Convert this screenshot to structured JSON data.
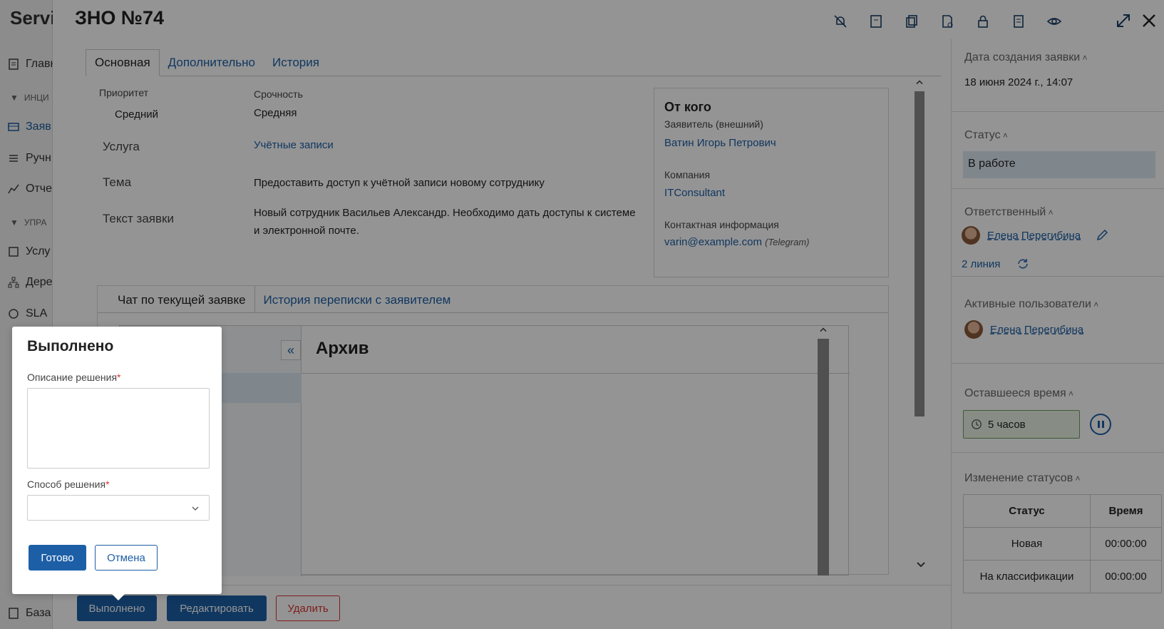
{
  "app": {
    "logo": "Servi",
    "nav": [
      {
        "label": "Главн",
        "icon": "document-icon"
      },
      {
        "label": "ИНЦИ",
        "group": true
      },
      {
        "label": "Заяв",
        "icon": "requests-icon",
        "active": true
      },
      {
        "label": "Ручн",
        "icon": "list-icon"
      },
      {
        "label": "Отче",
        "icon": "chart-icon"
      },
      {
        "label": "УПРА",
        "group": true
      },
      {
        "label": "Услу",
        "icon": "services-icon"
      },
      {
        "label": "Дере",
        "icon": "tree-icon"
      },
      {
        "label": "SLA",
        "icon": "sla-icon"
      },
      {
        "label": "База",
        "icon": "knowledge-icon"
      }
    ]
  },
  "request": {
    "title": "ЗНО №74",
    "tabs": [
      "Основная",
      "Дополнительно",
      "История"
    ],
    "priority_label": "Приоритет",
    "priority_value": "Средний",
    "urgency_label": "Срочность",
    "urgency_value": "Средняя",
    "service_label": "Услуга",
    "service_value": "Учётные записи",
    "topic_label": "Тема",
    "topic_value": "Предоставить доступ к учётной записи новому сотруднику",
    "text_label": "Текст заявки",
    "text_value_line1": "Новый сотрудник Васильев Александр. Необходимо дать доступы к системе",
    "text_value_line2": "и электронной почте."
  },
  "from": {
    "title": "От кого",
    "applicant_label": "Заявитель (внешний)",
    "applicant_value": "Ватин Игорь Петрович",
    "company_label": "Компания",
    "company_value": "ITConsultant",
    "contact_label": "Контактная информация",
    "contact_value": "varin@example.com",
    "contact_channel": "(Telegram)"
  },
  "chat": {
    "tabs": [
      "Чат по текущей заявке",
      "История переписки с заявителем"
    ],
    "title": "Архив"
  },
  "actions": {
    "done": "Выполнено",
    "edit": "Редактировать",
    "delete": "Удалить"
  },
  "right": {
    "created_label": "Дата создания заявки",
    "created_value": "18 июня 2024 г., 14:07",
    "status_label": "Статус",
    "status_value": "В работе",
    "responsible_label": "Ответственный",
    "responsible_name": "Елена Перегибина",
    "line": "2 линия",
    "active_users_label": "Активные пользователи",
    "active_user_name": "Елена Перегибина",
    "remaining_label": "Оставшееся время",
    "remaining_value": "5 часов",
    "status_changes_label": "Изменение статусов",
    "table_headers": [
      "Статус",
      "Время"
    ],
    "table_rows": [
      [
        "Новая",
        "00:00:00"
      ],
      [
        "На классификации",
        "00:00:00"
      ]
    ]
  },
  "modal": {
    "title": "Выполнено",
    "description_label": "Описание решения",
    "method_label": "Способ решения",
    "required_mark": "*",
    "submit": "Готово",
    "cancel": "Отмена"
  }
}
